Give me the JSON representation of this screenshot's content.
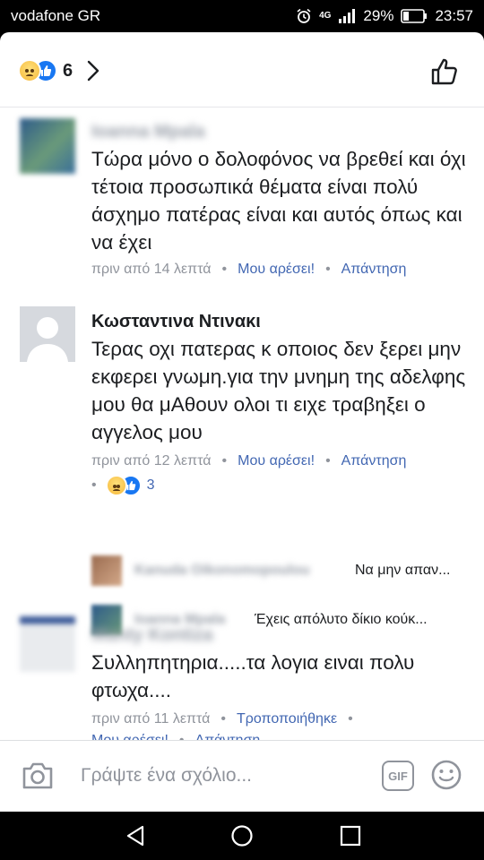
{
  "status_bar": {
    "carrier": "vodafone GR",
    "network": "4G",
    "battery": "29%",
    "time": "23:57"
  },
  "header": {
    "reaction_icons": [
      "sad-reaction-icon",
      "like-reaction-icon"
    ],
    "reaction_count": "6"
  },
  "comments": [
    {
      "author": "Ioanna Mpala",
      "text": "Τώρα μόνο ο δολοφόνος να βρεθεί και όχι τέτοια προσωπικά θέματα είναι πολύ άσχημο πατέρας είναι και αυτός όπως και να έχει",
      "time": "πριν από 14 λεπτά",
      "like_label": "Μου αρέσει!",
      "reply_label": "Απάντηση"
    },
    {
      "author": "Κωσταντινα Ντινακι",
      "text": "Τερας οχι πατερας κ οποιος δεν ξερει μην εκφερει γνωμη.για την μνημη της αδελφης μου θα μΑθουν ολοι τι ειχε τραβηξει ο αγγελος μου",
      "time": "πριν από 12 λεπτά",
      "like_label": "Μου αρέσει!",
      "reply_label": "Απάντηση",
      "reaction_count": "3",
      "replies": [
        {
          "author": "Kanuda Oikonomopoulou",
          "text": "Να μην απαν..."
        },
        {
          "author": "Ioanna Mpala",
          "text": "Έχεις απόλυτο δίκιο κούκ..."
        }
      ]
    },
    {
      "author": "Manty Kontiza",
      "text": "Συλληπητηρια.....τα λογια ειναι πολυ φτωχα....",
      "time": "πριν από 11 λεπτά",
      "edited_label": "Τροποποιήθηκε",
      "like_label": "Μου αρέσει!",
      "reply_label": "Απάντηση"
    }
  ],
  "composer": {
    "placeholder": "Γράψτε ένα σχόλιο...",
    "gif_label": "GIF"
  },
  "colors": {
    "link": "#4267b2",
    "meta": "#90949c",
    "text": "#1c1e21",
    "like_blue": "#1877f2"
  }
}
